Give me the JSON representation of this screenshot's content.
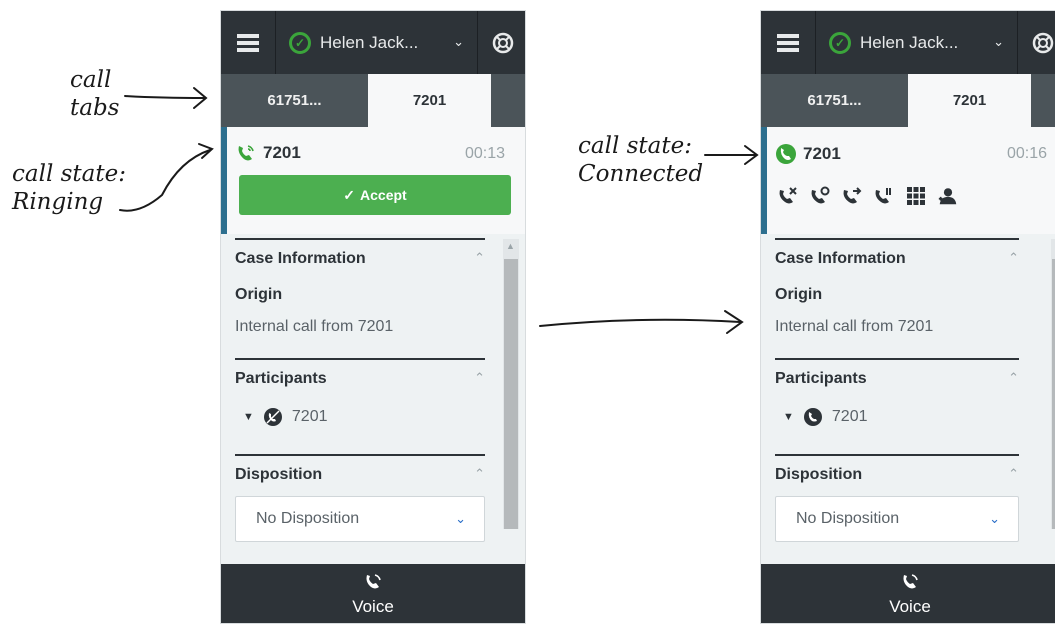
{
  "annotations": {
    "call_tabs": [
      "call",
      "tabs"
    ],
    "ringing": [
      "call state:",
      "Ringing"
    ],
    "connected": [
      "call state:",
      "Connected"
    ]
  },
  "panel_ringing": {
    "header": {
      "user_name": "Helen Jack...",
      "status": "ready",
      "menu_icon": "hamburger-icon",
      "help_icon": "lifebuoy-icon"
    },
    "tabs": [
      {
        "label": "61751..."
      },
      {
        "label": "7201"
      }
    ],
    "call": {
      "number": "7201",
      "timer": "00:13",
      "state": "ringing",
      "accept_label": "Accept"
    },
    "case_info": {
      "title": "Case Information",
      "origin_label": "Origin",
      "origin_value": "Internal call from 7201"
    },
    "participants": {
      "title": "Participants",
      "participant": "7201"
    },
    "disposition": {
      "title": "Disposition",
      "value": "No Disposition"
    },
    "footer": {
      "label": "Voice"
    }
  },
  "panel_connected": {
    "header": {
      "user_name": "Helen Jack...",
      "status": "ready",
      "menu_icon": "hamburger-icon",
      "help_icon": "lifebuoy-icon"
    },
    "tabs": [
      {
        "label": "61751..."
      },
      {
        "label": "7201"
      }
    ],
    "call": {
      "number": "7201",
      "timer": "00:16",
      "state": "connected",
      "actions": [
        "hang-up-icon",
        "hold-icon",
        "transfer-icon",
        "consult-icon",
        "dialpad-icon",
        "conference-icon"
      ]
    },
    "case_info": {
      "title": "Case Information",
      "origin_label": "Origin",
      "origin_value": "Internal call from 7201"
    },
    "participants": {
      "title": "Participants",
      "participant": "7201"
    },
    "disposition": {
      "title": "Disposition",
      "value": "No Disposition"
    },
    "footer": {
      "label": "Voice"
    }
  },
  "colors": {
    "accept_green": "#4caf50",
    "status_green": "#3ba53b",
    "dark_header": "#2d3338",
    "call_state_bar": "#2d6f8e"
  }
}
